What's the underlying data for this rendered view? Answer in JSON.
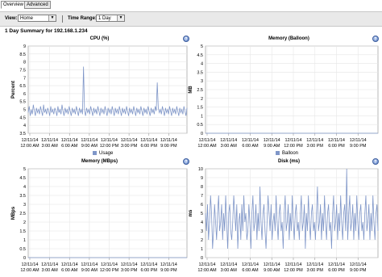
{
  "tabs": [
    {
      "label": "Overview"
    },
    {
      "label": "Advanced"
    }
  ],
  "toolbar": {
    "view_label": "View:",
    "view_value": "Home",
    "time_range_label": "Time Range:",
    "time_range_value": "1 Day"
  },
  "summary_title": "1 Day Summary for 192.168.1.234",
  "icons": {
    "help": "help-icon",
    "dropdown": "chevron-down-icon"
  },
  "colors": {
    "series": "#7f96c8",
    "grid": "#e6e6e6",
    "axis": "#9a9a9a"
  },
  "chart_data": [
    {
      "type": "line",
      "title": "CPU (%)",
      "ylabel": "Percent",
      "xlabel": "",
      "ylim": [
        3.5,
        9.0
      ],
      "yticks": [
        "3.5",
        "4",
        "4.5",
        "5",
        "5.5",
        "6",
        "6.5",
        "7",
        "7.5",
        "8",
        "8.5",
        "9"
      ],
      "xticks": [
        [
          "12/11/14",
          "12:00 AM"
        ],
        [
          "12/11/14",
          "3:00 AM"
        ],
        [
          "12/11/14",
          "6:00 AM"
        ],
        [
          "12/11/14",
          "9:00 AM"
        ],
        [
          "12/11/14",
          "12:00 PM"
        ],
        [
          "12/11/14",
          "3:00 PM"
        ],
        [
          "12/11/14",
          "6:00 PM"
        ],
        [
          "12/11/14",
          "9:00 PM"
        ]
      ],
      "legend": "Usage",
      "grid": true,
      "series": [
        {
          "name": "Usage",
          "values": [
            4.8,
            5.2,
            4.6,
            5.0,
            4.7,
            5.3,
            4.9,
            4.6,
            5.1,
            4.8,
            5.0,
            4.7,
            5.2,
            4.9,
            4.6,
            5.3,
            4.8,
            5.0,
            4.7,
            5.1,
            4.9,
            4.6,
            5.2,
            4.8,
            5.0,
            4.7,
            5.1,
            4.9,
            4.6,
            5.2,
            4.8,
            5.0,
            4.7,
            5.3,
            4.9,
            4.6,
            5.1,
            4.8,
            5.0,
            4.7,
            5.2,
            4.9,
            4.6,
            5.1,
            4.8,
            5.0,
            4.7,
            5.2,
            4.9,
            4.6,
            5.1,
            4.8,
            5.0,
            4.7,
            7.7,
            4.9,
            4.6,
            5.1,
            4.8,
            5.0,
            4.7,
            5.2,
            4.9,
            4.6,
            5.1,
            4.8,
            5.0,
            4.7,
            5.2,
            4.9,
            4.6,
            5.1,
            4.8,
            5.0,
            4.7,
            5.2,
            4.9,
            4.6,
            5.1,
            4.8,
            5.0,
            4.7,
            5.2,
            4.9,
            4.6,
            5.1,
            4.8,
            5.0,
            4.7,
            5.2,
            4.9,
            4.6,
            5.1,
            4.8,
            5.0,
            4.7,
            5.2,
            4.9,
            4.6,
            5.1,
            4.8,
            5.0,
            4.7,
            5.2,
            4.9,
            4.6,
            5.1,
            4.8,
            5.0,
            4.7,
            5.2,
            4.9,
            4.6,
            5.1,
            4.8,
            5.0,
            4.7,
            5.2,
            4.9,
            4.6,
            5.1,
            4.8,
            5.0,
            4.7,
            5.2,
            4.9,
            6.7,
            5.1,
            4.8,
            5.0,
            4.7,
            5.2,
            4.9,
            4.6,
            5.1,
            4.8,
            5.0,
            4.7,
            5.2,
            4.9,
            4.6,
            5.1,
            4.8,
            5.0,
            4.7,
            5.2,
            4.9,
            4.6,
            5.1,
            4.8,
            5.0,
            4.7,
            5.2,
            4.9,
            4.6,
            5.1
          ]
        }
      ]
    },
    {
      "type": "line",
      "title": "Memory (Balloon)",
      "ylabel": "MB",
      "xlabel": "",
      "ylim": [
        0,
        5
      ],
      "yticks": [
        "0",
        "0.5",
        "1",
        "1.5",
        "2",
        "2.5",
        "3",
        "3.5",
        "4",
        "4.5",
        "5"
      ],
      "xticks": [
        [
          "12/11/14",
          "12:00 AM"
        ],
        [
          "12/11/14",
          "3:00 AM"
        ],
        [
          "12/11/14",
          "6:00 AM"
        ],
        [
          "12/11/14",
          "9:00 AM"
        ],
        [
          "12/11/14",
          "12:00 PM"
        ],
        [
          "12/11/14",
          "3:00 PM"
        ],
        [
          "12/11/14",
          "6:00 PM"
        ],
        [
          "12/11/14",
          "9:00 PM"
        ]
      ],
      "legend": "Balloon",
      "grid": true,
      "series": [
        {
          "name": "Balloon",
          "values": [
            0,
            0,
            0,
            0,
            0,
            0,
            0,
            0,
            0,
            0,
            0,
            0,
            0,
            0,
            0,
            0,
            0,
            0,
            0,
            0
          ]
        }
      ]
    },
    {
      "type": "line",
      "title": "Memory (MBps)",
      "ylabel": "MBps",
      "xlabel": "",
      "ylim": [
        0,
        5
      ],
      "yticks": [
        "0",
        "0.5",
        "1",
        "1.5",
        "2",
        "2.5",
        "3",
        "3.5",
        "4",
        "4.5",
        "5"
      ],
      "xticks": [
        [
          "12/11/14",
          "12:00 AM"
        ],
        [
          "12/11/14",
          "3:00 AM"
        ],
        [
          "12/11/14",
          "6:00 AM"
        ],
        [
          "12/11/14",
          "9:00 AM"
        ],
        [
          "12/11/14",
          "12:00 PM"
        ],
        [
          "12/11/14",
          "3:00 PM"
        ],
        [
          "12/11/14",
          "6:00 PM"
        ],
        [
          "12/11/14",
          "9:00 PM"
        ]
      ],
      "legend": "",
      "grid": true,
      "series": [
        {
          "name": "",
          "values": [
            0,
            0,
            0,
            0,
            0,
            0,
            0,
            0,
            0,
            0,
            0,
            0,
            0,
            0,
            0,
            0,
            0,
            0,
            0,
            0
          ]
        }
      ]
    },
    {
      "type": "line",
      "title": "Disk (ms)",
      "ylabel": "ms",
      "xlabel": "",
      "ylim": [
        0,
        10
      ],
      "yticks": [
        "0",
        "1",
        "2",
        "3",
        "4",
        "5",
        "6",
        "7",
        "8",
        "9",
        "10"
      ],
      "xticks": [
        [
          "12/11/14",
          "12:00 AM"
        ],
        [
          "12/11/14",
          "3:00 AM"
        ],
        [
          "12/11/14",
          "6:00 AM"
        ],
        [
          "12/11/14",
          "9:00 AM"
        ],
        [
          "12/11/14",
          "12:00 PM"
        ],
        [
          "12/11/14",
          "3:00 PM"
        ],
        [
          "12/11/14",
          "6:00 PM"
        ],
        [
          "12/11/14",
          "9:00 PM"
        ]
      ],
      "legend": "",
      "grid": true,
      "series": [
        {
          "name": "",
          "values": [
            5,
            3,
            6,
            2,
            4,
            7,
            5,
            1,
            3,
            6,
            4,
            2,
            5,
            7,
            3,
            4,
            6,
            2,
            5,
            3,
            7,
            4,
            1,
            5,
            6,
            3,
            2,
            4,
            7,
            5,
            3,
            6,
            1,
            4,
            5,
            2,
            6,
            3,
            7,
            4,
            5,
            2,
            3,
            6,
            4,
            1,
            5,
            7,
            3,
            4,
            6,
            2,
            5,
            3,
            8,
            4,
            2,
            5,
            6,
            3,
            1,
            4,
            7,
            5,
            3,
            6,
            2,
            4,
            5,
            3,
            7,
            4,
            2,
            5,
            6,
            3,
            4,
            1,
            5,
            7,
            3,
            4,
            6,
            2,
            5,
            3,
            7,
            4,
            2,
            5,
            6,
            3,
            4,
            2,
            5,
            7,
            3,
            4,
            6,
            1,
            5,
            3,
            7,
            4,
            2,
            5,
            6,
            3,
            4,
            2,
            5,
            8,
            3,
            4,
            6,
            2,
            5,
            3,
            7,
            4,
            2,
            5,
            6,
            3,
            4,
            1,
            5,
            7,
            3,
            4,
            6,
            2,
            5,
            3,
            7,
            4,
            2,
            5,
            6,
            3,
            10,
            2,
            5,
            7,
            3,
            4,
            6,
            2,
            5,
            3,
            7,
            4,
            2,
            5,
            6,
            3,
            4,
            2,
            5,
            7,
            3,
            4,
            6,
            2,
            5,
            3,
            7,
            4,
            2,
            5,
            6,
            3
          ]
        }
      ]
    }
  ]
}
